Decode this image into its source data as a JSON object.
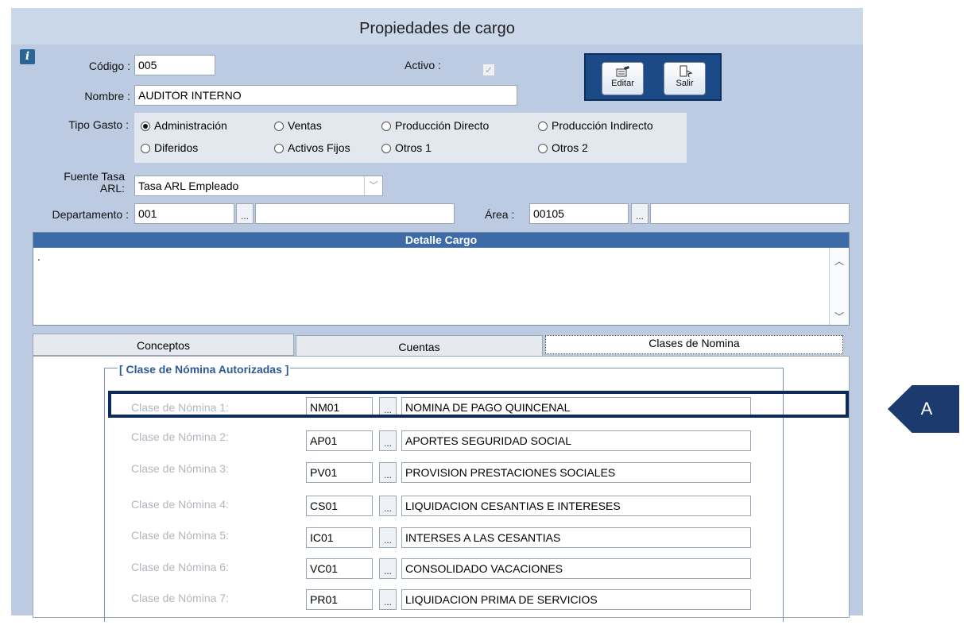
{
  "window": {
    "title": "Propiedades de cargo"
  },
  "info_icon": "info-icon",
  "fields": {
    "codigo_label": "Código :",
    "codigo_value": "005",
    "activo_label": "Activo :",
    "activo_checked": true,
    "nombre_label": "Nombre :",
    "nombre_value": "AUDITOR INTERNO",
    "tipo_gasto_label": "Tipo Gasto :",
    "fuente_label_1": "Fuente Tasa",
    "fuente_label_2": "ARL:",
    "fuente_value": "Tasa ARL Empleado",
    "departamento_label": "Departamento :",
    "departamento_value": "001",
    "departamento_desc": "",
    "area_label": "Área :",
    "area_value": "00105",
    "area_desc": ""
  },
  "toolbar": {
    "editar_label": "Editar",
    "salir_label": "Salir"
  },
  "tipo_gasto": {
    "selected": "Administración",
    "options": [
      "Administración",
      "Ventas",
      "Producción Directo",
      "Producción Indirecto",
      "Diferidos",
      "Activos Fijos",
      "Otros 1",
      "Otros 2"
    ]
  },
  "detalle": {
    "header": "Detalle Cargo",
    "text": "."
  },
  "tabs": [
    {
      "label": "Conceptos",
      "active": false
    },
    {
      "label": "Cuentas",
      "active": false
    },
    {
      "label": "Clases de Nomina",
      "active": true
    }
  ],
  "group_title": "[ Clase de Nómina Autorizadas ]",
  "nomina_rows": [
    {
      "label": "Clase de Nómina 1:",
      "code": "NM01",
      "desc": "NOMINA DE PAGO QUINCENAL"
    },
    {
      "label": "Clase de Nómina 2:",
      "code": "AP01",
      "desc": "APORTES SEGURIDAD SOCIAL"
    },
    {
      "label": "Clase de Nómina 3:",
      "code": "PV01",
      "desc": "PROVISION PRESTACIONES SOCIALES"
    },
    {
      "label": "Clase de Nómina 4:",
      "code": "CS01",
      "desc": "LIQUIDACION CESANTIAS E INTERESES"
    },
    {
      "label": "Clase de Nómina 5:",
      "code": "IC01",
      "desc": "INTERSES A LAS CESANTIAS"
    },
    {
      "label": "Clase de Nómina 6:",
      "code": "VC01",
      "desc": "CONSOLIDADO VACACIONES"
    },
    {
      "label": "Clase de Nómina 7:",
      "code": "PR01",
      "desc": "LIQUIDACION PRIMA DE SERVICIOS"
    }
  ],
  "browse_label": "...",
  "callout": {
    "label": "A"
  },
  "colors": {
    "window_bg": "#bccbe1",
    "header_blue": "#3d6ba8",
    "highlight": "#0c2a5a",
    "group_title": "#2c5a95"
  }
}
